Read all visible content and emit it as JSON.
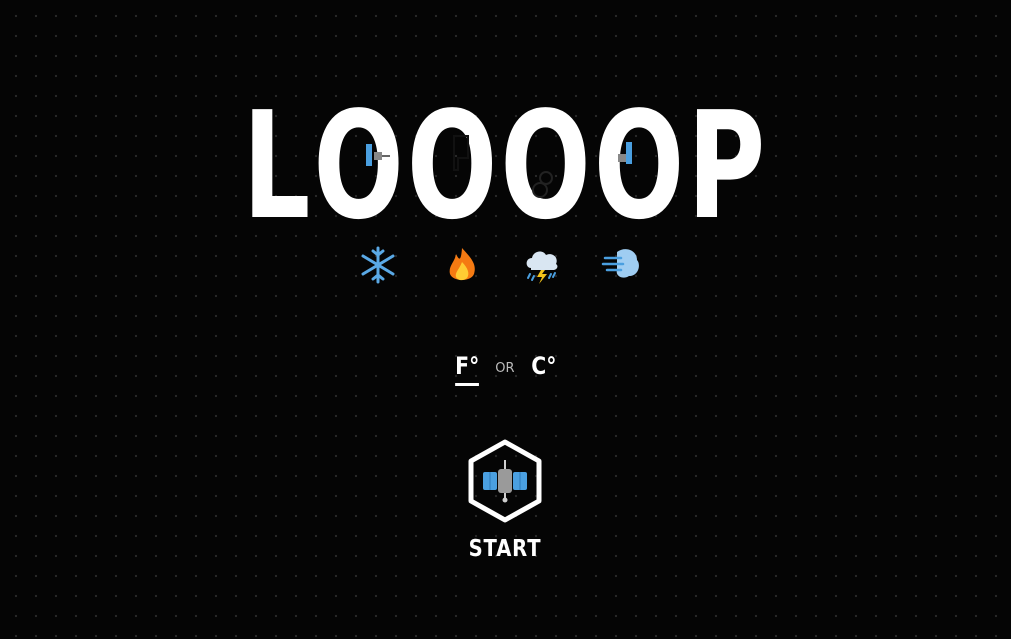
{
  "logo": {
    "letters": [
      "L",
      "O",
      "O",
      "O",
      "O",
      "P"
    ]
  },
  "weather_icons": [
    {
      "name": "snowflake-icon",
      "glyph": "❄",
      "color": "#5aa9e6"
    },
    {
      "name": "fire-icon",
      "glyph": "🔥",
      "color": "#f7a11a"
    },
    {
      "name": "storm-cloud-icon",
      "glyph": "⛈",
      "color": "#8fb6d9"
    },
    {
      "name": "wind-icon",
      "glyph": "🌬",
      "color": "#7fb7e8"
    }
  ],
  "units": {
    "fahrenheit": "F°",
    "or": "OR",
    "celsius": "C°",
    "selected": "fahrenheit"
  },
  "start": {
    "label": "START",
    "icon": "satellite-icon"
  },
  "colors": {
    "background": "#050505",
    "text": "#ffffff",
    "accent_blue": "#4a9fe0"
  }
}
